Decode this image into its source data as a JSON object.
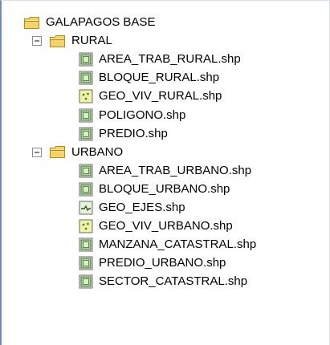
{
  "tree": {
    "root": {
      "label": "GALAPAGOS BASE",
      "icon": "folder-icon"
    },
    "groups": [
      {
        "label": "RURAL",
        "icon": "folder-icon",
        "expander": "collapse-minus-icon",
        "expanded": true,
        "items": [
          {
            "label": "AREA_TRAB_RURAL.shp",
            "icon": "polygon-layer-icon"
          },
          {
            "label": "BLOQUE_RURAL.shp",
            "icon": "polygon-layer-icon"
          },
          {
            "label": "GEO_VIV_RURAL.shp",
            "icon": "point-layer-icon"
          },
          {
            "label": "POLIGONO.shp",
            "icon": "polygon-layer-icon"
          },
          {
            "label": "PREDIO.shp",
            "icon": "polygon-layer-icon"
          }
        ]
      },
      {
        "label": "URBANO",
        "icon": "folder-icon",
        "expander": "collapse-minus-icon",
        "expanded": true,
        "items": [
          {
            "label": "AREA_TRAB_URBANO.shp",
            "icon": "polygon-layer-icon"
          },
          {
            "label": "BLOQUE_URBANO.shp",
            "icon": "polygon-layer-icon"
          },
          {
            "label": "GEO_EJES.shp",
            "icon": "line-layer-icon"
          },
          {
            "label": "GEO_VIV_URBANO.shp",
            "icon": "point-layer-icon"
          },
          {
            "label": "MANZANA_CATASTRAL.shp",
            "icon": "polygon-layer-icon"
          },
          {
            "label": "PREDIO_URBANO.shp",
            "icon": "polygon-layer-icon"
          },
          {
            "label": "SECTOR_CATASTRAL.shp",
            "icon": "polygon-layer-icon"
          }
        ]
      }
    ]
  },
  "colors": {
    "folder_fill": "#f4d36b",
    "folder_stroke": "#b38a1d",
    "polygon_fill": "#a9d996",
    "polygon_stroke": "#4a6b3a",
    "point_fill": "#eef4a6",
    "line_fill": "#e8f2d7",
    "panel_border": "#6f8fb6"
  }
}
